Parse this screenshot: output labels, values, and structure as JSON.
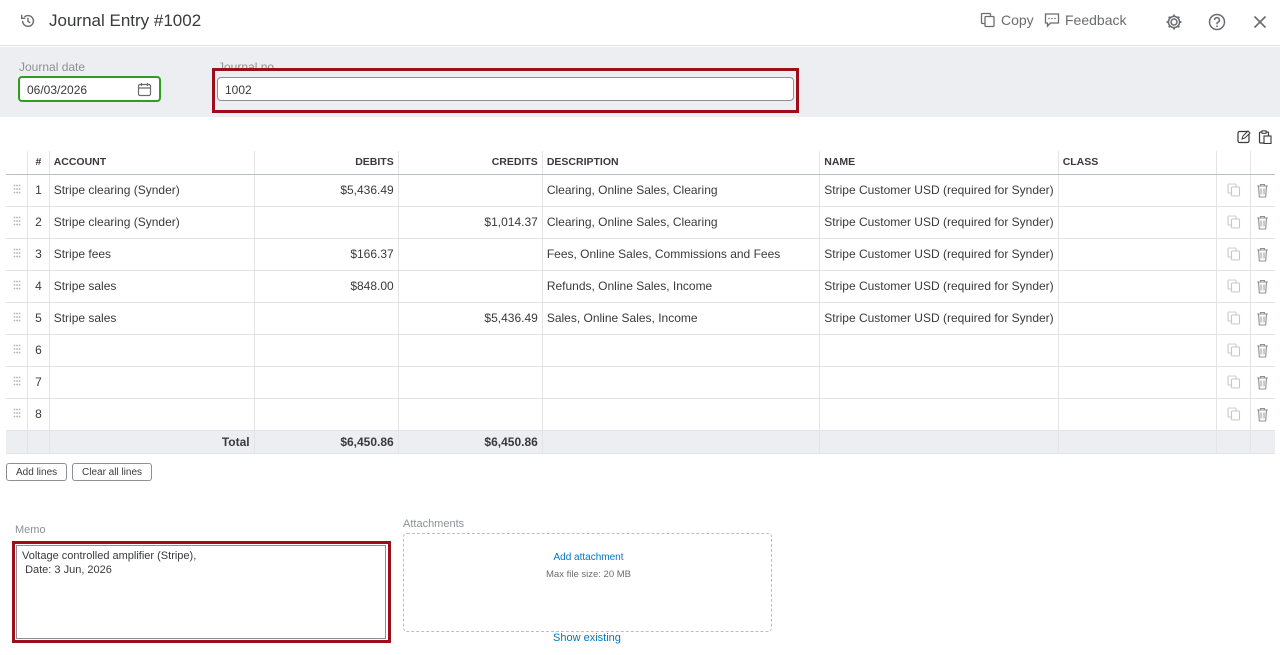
{
  "header": {
    "title": "Journal Entry #1002",
    "copy_label": "Copy",
    "feedback_label": "Feedback"
  },
  "form": {
    "journal_date_label": "Journal date",
    "journal_date_value": "06/03/2026",
    "journal_no_label": "Journal no.",
    "journal_no_value": "1002"
  },
  "table": {
    "columns": [
      "#",
      "ACCOUNT",
      "DEBITS",
      "CREDITS",
      "DESCRIPTION",
      "NAME",
      "CLASS"
    ],
    "rows": [
      {
        "n": "1",
        "account": "Stripe clearing (Synder)",
        "debit": "$5,436.49",
        "credit": "",
        "description": "Clearing, Online Sales, Clearing",
        "name": "Stripe Customer USD (required for Synder)",
        "class": ""
      },
      {
        "n": "2",
        "account": "Stripe clearing (Synder)",
        "debit": "",
        "credit": "$1,014.37",
        "description": "Clearing, Online Sales, Clearing",
        "name": "Stripe Customer USD (required for Synder)",
        "class": ""
      },
      {
        "n": "3",
        "account": "Stripe fees",
        "debit": "$166.37",
        "credit": "",
        "description": "Fees, Online Sales, Commissions and Fees",
        "name": "Stripe Customer USD (required for Synder)",
        "class": ""
      },
      {
        "n": "4",
        "account": "Stripe sales",
        "debit": "$848.00",
        "credit": "",
        "description": "Refunds, Online Sales, Income",
        "name": "Stripe Customer USD (required for Synder)",
        "class": ""
      },
      {
        "n": "5",
        "account": "Stripe sales",
        "debit": "",
        "credit": "$5,436.49",
        "description": "Sales, Online Sales, Income",
        "name": "Stripe Customer USD (required for Synder)",
        "class": ""
      },
      {
        "n": "6",
        "account": "",
        "debit": "",
        "credit": "",
        "description": "",
        "name": "",
        "class": ""
      },
      {
        "n": "7",
        "account": "",
        "debit": "",
        "credit": "",
        "description": "",
        "name": "",
        "class": ""
      },
      {
        "n": "8",
        "account": "",
        "debit": "",
        "credit": "",
        "description": "",
        "name": "",
        "class": ""
      }
    ],
    "total_label": "Total",
    "total_debits": "$6,450.86",
    "total_credits": "$6,450.86"
  },
  "buttons": {
    "add_lines": "Add lines",
    "clear_all_lines": "Clear all lines"
  },
  "memo": {
    "label": "Memo",
    "value": "Voltage controlled amplifier (Stripe),\n Date: 3 Jun, 2026"
  },
  "attachments": {
    "label": "Attachments",
    "add_label": "Add attachment",
    "hint": "Max file size: 20 MB",
    "show_existing": "Show existing"
  },
  "colors": {
    "accent_green": "#2ca01c",
    "highlight_red": "#9b0f1a",
    "link_blue": "#0077c5"
  }
}
